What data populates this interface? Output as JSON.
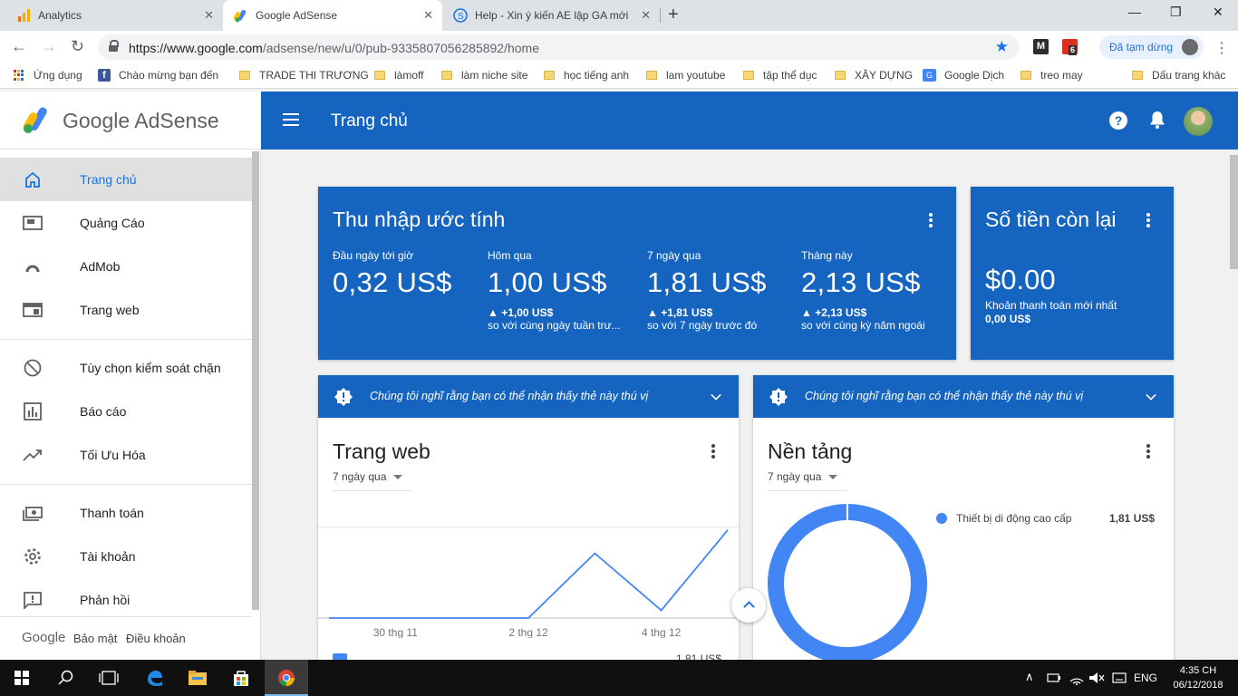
{
  "browser": {
    "tabs": [
      {
        "title": "Analytics",
        "active": false
      },
      {
        "title": "Google AdSense",
        "active": true
      },
      {
        "title": "Help - Xin ý kiến AE lập GA mới",
        "active": false
      }
    ],
    "url": "https://www.google.com/adsense/new/u/0/pub-9335807056285892/home",
    "url_host": "https://www.google.com",
    "url_path": "/adsense/new/u/0/pub-9335807056285892/home",
    "extension_badge": "6",
    "sync_status": "Đã tạm dừng",
    "bookmarks": [
      "Ứng dụng",
      "Chào mừng bạn đến",
      "TRADE THI TRƯƠNG",
      "làmoff",
      "làm niche site",
      "học tiếng anh",
      "lam youtube",
      "tập thể dục",
      "XÂY DỰNG",
      "Google Dịch",
      "treo may",
      "Dấu trang khác"
    ]
  },
  "app": {
    "logo_text": "Google AdSense",
    "page_title": "Trang chủ",
    "help_glyph": "?"
  },
  "sidebar": {
    "items": [
      {
        "label": "Trang chủ",
        "icon": "home-icon",
        "active": true
      },
      {
        "label": "Quảng Cáo",
        "icon": "ads-icon"
      },
      {
        "label": "AdMob",
        "icon": "admob-icon"
      },
      {
        "label": "Trang web",
        "icon": "sites-icon"
      },
      {
        "label": "Tùy chọn kiểm soát chặn",
        "icon": "block-icon"
      },
      {
        "label": "Báo cáo",
        "icon": "reports-icon"
      },
      {
        "label": "Tối Ưu Hóa",
        "icon": "optimize-icon"
      },
      {
        "label": "Thanh toán",
        "icon": "payments-icon"
      },
      {
        "label": "Tài khoản",
        "icon": "settings-icon"
      },
      {
        "label": "Phản hồi",
        "icon": "feedback-icon"
      }
    ],
    "footer": {
      "brand": "Google",
      "privacy": "Bảo mật",
      "terms": "Điều khoản"
    }
  },
  "earnings": {
    "title": "Thu nhập ước tính",
    "metrics": [
      {
        "label": "Đầu ngày tới giờ",
        "value": "0,32 US$",
        "delta": "",
        "note": ""
      },
      {
        "label": "Hôm qua",
        "value": "1,00 US$",
        "delta": "▲ +1,00 US$",
        "note": "so với cùng ngày tuần trư..."
      },
      {
        "label": "7 ngày qua",
        "value": "1,81 US$",
        "delta": "▲ +1,81 US$",
        "note": "so với 7 ngày trước đó"
      },
      {
        "label": "Tháng này",
        "value": "2,13 US$",
        "delta": "▲ +2,13 US$",
        "note": "so với cùng kỳ năm ngoái"
      }
    ]
  },
  "balance": {
    "title": "Số tiền còn lại",
    "value": "$0.00",
    "last_payment_label": "Khoản thanh toán mới nhất",
    "last_payment_value": "0,00 US$"
  },
  "notice_text": "Chúng tôi nghĩ rằng bạn có thể nhận thấy thẻ này thú vị",
  "sites_card": {
    "title": "Trang web",
    "period": "7 ngày qua",
    "partial_row_value": "1,81 US$"
  },
  "platform_card": {
    "title": "Nền tảng",
    "period": "7 ngày qua",
    "legend_label": "Thiết bị di động cao cấp",
    "legend_value": "1,81 US$"
  },
  "chart_data": [
    {
      "type": "line",
      "x": [
        "29 thg 11",
        "30 thg 11",
        "1 thg 12",
        "2 thg 12",
        "3 thg 12",
        "4 thg 12",
        "5 thg 12"
      ],
      "tick_labels": [
        "30 thg 11",
        "2 thg 12",
        "4 thg 12"
      ],
      "values": [
        0,
        0,
        0,
        0,
        0.5,
        0.06,
        0.68
      ],
      "title": "",
      "xlabel": "",
      "ylabel": "",
      "grid": false
    },
    {
      "type": "pie",
      "donut": true,
      "slices": [
        {
          "name": "Thiết bị di động cao cấp",
          "value": 1.81
        }
      ],
      "color": "#4285f4"
    }
  ],
  "taskbar": {
    "language": "ENG",
    "time": "4:35 CH",
    "date": "06/12/2018"
  },
  "colors": {
    "primary": "#1565c0",
    "accent": "#1a73e8",
    "chart_blue": "#4285f4"
  }
}
